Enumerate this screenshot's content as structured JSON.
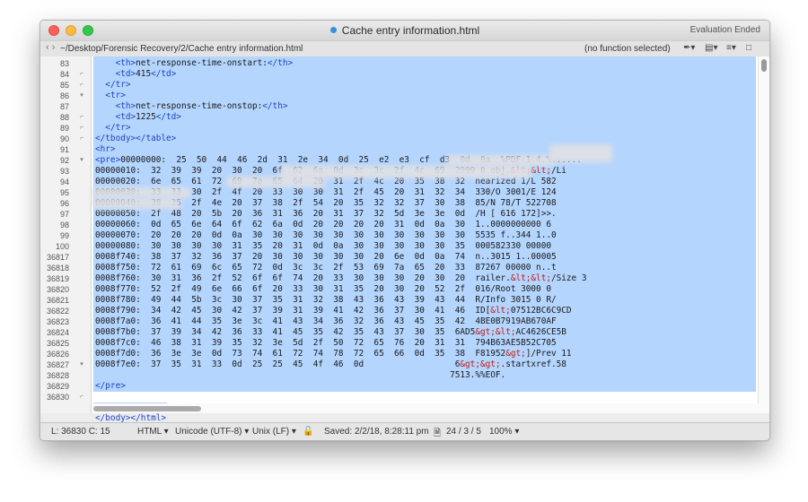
{
  "window": {
    "title": "Cache entry information.html",
    "eval_text": "Evaluation Ended"
  },
  "pathbar": {
    "nav": "‹ ›",
    "path": "~/Desktop/Forensic Recovery/2/Cache entry information.html",
    "function": "(no function selected)",
    "tools": [
      "✒▾",
      "▤▾",
      "≡▾",
      "□"
    ]
  },
  "lines": [
    {
      "num": "83",
      "fold": "",
      "text": "    <th>net-response-time-onstart:</th>"
    },
    {
      "num": "84",
      "fold": "⌐",
      "text": "    <td>415</td>"
    },
    {
      "num": "85",
      "fold": "⌐",
      "text": "  </tr>"
    },
    {
      "num": "86",
      "fold": "▾",
      "text": "  <tr>"
    },
    {
      "num": "87",
      "fold": "",
      "text": "    <th>net-response-time-onstop:</th>"
    },
    {
      "num": "88",
      "fold": "⌐",
      "text": "    <td>1225</td>"
    },
    {
      "num": "89",
      "fold": "⌐",
      "text": "  </tr>"
    },
    {
      "num": "90",
      "fold": "⌐",
      "text": "</tbody></table>"
    },
    {
      "num": "91",
      "fold": "",
      "text": "<hr>"
    },
    {
      "num": "92",
      "fold": "▾",
      "text": "<pre>00000000:  25  50  44  46  2d  31  2e  34  0d  25  e2  e3  cf  d3  0d  0a  %PDF-1.4.%......"
    },
    {
      "num": "93",
      "fold": "",
      "text": "00000010:  32  39  39  20  30  20  6f  62  6a  0d  3c  3c  2f  4c  69  2999 0 obj.&lt;&lt;/Li"
    },
    {
      "num": "94",
      "fold": "",
      "text": "00000020:  6e  65  61  72  69  7a  65  64  20  31  2f  4c  20  35  38  32  nearized 1/L 582"
    },
    {
      "num": "95",
      "fold": "",
      "text": "00000030:  33  33  30  2f  4f  20  33  30  30  31  2f  45  20  31  32  34  330/O 3001/E 124"
    },
    {
      "num": "96",
      "fold": "",
      "text": "00000040:  38  35  2f  4e  20  37  38  2f  54  20  35  32  32  37  30  38  85/N 78/T 522708"
    },
    {
      "num": "97",
      "fold": "",
      "text": "00000050:  2f  48  20  5b  20  36  31  36  20  31  37  32  5d  3e  3e  0d  /H [ 616 172]>>."
    },
    {
      "num": "98",
      "fold": "",
      "text": "00000060:  0d  65  6e  64  6f  62  6a  0d  20  20  20  20  31  0d  0a  30  1..0000000000 6"
    },
    {
      "num": "99",
      "fold": "",
      "text": "00000070:  20  20  20  0d  0a  30  30  30  30  30  30  30  30  30  30  30  5535 f..344 1..0"
    },
    {
      "num": "100",
      "fold": "",
      "text": "00000080:  30  30  30  30  31  35  20  31  0d  0a  30  30  30  30  30  35  000582330 00000"
    },
    {
      "num": "36817",
      "fold": "",
      "text": "0008f740:  38  37  32  36  37  20  30  30  30  30  30  20  6e  0d  0a  74  n..3015 1..00005"
    },
    {
      "num": "36818",
      "fold": "",
      "text": "0008f750:  72  61  69  6c  65  72  0d  3c  3c  2f  53  69  7a  65  20  33  87267 00000 n..t"
    },
    {
      "num": "36819",
      "fold": "",
      "text": "0008f760:  30  31  36  2f  52  6f  6f  74  20  33  30  30  30  20  30  20  railer.&lt;&lt;/Size 3"
    },
    {
      "num": "36820",
      "fold": "",
      "text": "0008f770:  52  2f  49  6e  66  6f  20  33  30  31  35  20  30  20  52  2f  016/Root 3000 0"
    },
    {
      "num": "36821",
      "fold": "",
      "text": "0008f780:  49  44  5b  3c  30  37  35  31  32  38  43  36  43  39  43  44  R/Info 3015 0 R/"
    },
    {
      "num": "36822",
      "fold": "",
      "text": "0008f790:  34  42  45  30  42  37  39  31  39  41  42  36  37  30  41  46  ID[&lt;07512BC6C9CD"
    },
    {
      "num": "36823",
      "fold": "",
      "text": "0008f7a0:  36  41  44  35  3e  3c  41  43  34  36  32  36  43  45  35  42  4BE0B7919AB670AF"
    },
    {
      "num": "36824",
      "fold": "",
      "text": "0008f7b0:  37  39  34  42  36  33  41  45  35  42  35  43  37  30  35  6AD5&gt;&lt;AC4626CE5B"
    },
    {
      "num": "36825",
      "fold": "",
      "text": "0008f7c0:  46  38  31  39  35  32  3e  5d  2f  50  72  65  76  20  31  31  794B63AE5B52C705"
    },
    {
      "num": "36826",
      "fold": "",
      "text": "0008f7d0:  36  3e  3e  0d  73  74  61  72  74  78  72  65  66  0d  35  38  F81952&gt;]/Prev 11"
    },
    {
      "num": "36827",
      "fold": "▾",
      "text": "0008f7e0:  37  35  31  33  0d  25  25  45  4f  46  0d                  6&gt;&gt;.startxref.58"
    },
    {
      "num": "36828",
      "fold": "",
      "text": "                                                                      7513.%%EOF."
    },
    {
      "num": "36829",
      "fold": "",
      "text": "</pre>"
    },
    {
      "num": "36830",
      "fold": "⌐",
      "text": ""
    },
    {
      "num": "",
      "fold": "",
      "text": ""
    },
    {
      "num": "",
      "fold": "",
      "text": "</body></html>"
    }
  ],
  "status": {
    "position": "L: 36830 C: 15",
    "language": "HTML ▾",
    "encoding": "Unicode (UTF-8) ▾",
    "line_endings": "Unix (LF) ▾",
    "lock": "🔓",
    "saved": "Saved: 2/2/18, 8:28:11 pm",
    "doc_icon": "🗎",
    "counts": "24 / 3 / 5",
    "zoom": "100% ▾"
  },
  "colors": {
    "selection": "#b4d5fe",
    "tag": "#1d44c0",
    "entity": "#c41a16"
  }
}
